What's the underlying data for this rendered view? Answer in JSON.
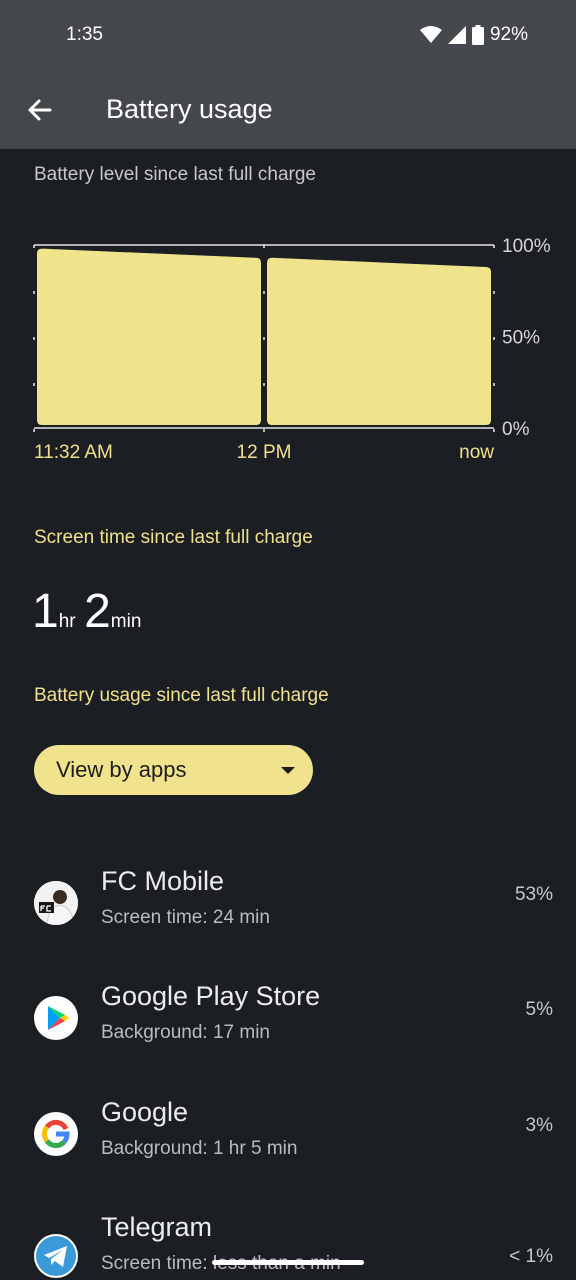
{
  "status": {
    "time": "1:35",
    "battery": "92%"
  },
  "header": {
    "title": "Battery usage"
  },
  "chart_label": "Battery level since last full charge",
  "chart_data": {
    "type": "area",
    "x_labels": [
      "11:32 AM",
      "12 PM",
      "now"
    ],
    "y_labels": [
      "100%",
      "50%",
      "0%"
    ],
    "ylim": [
      0,
      100
    ],
    "segments": [
      {
        "start": 98,
        "end": 93
      },
      {
        "start": 93,
        "end": 88
      }
    ],
    "colors": {
      "fill": "#efe38c",
      "axis": "#e6e6e6",
      "label": "#efe08c"
    }
  },
  "screen_time": {
    "title": "Screen time since last full charge",
    "hours": "1",
    "hours_unit": "hr",
    "minutes": "2",
    "minutes_unit": "min"
  },
  "usage": {
    "title": "Battery usage since last full charge",
    "dropdown": "View by apps"
  },
  "apps": [
    {
      "name": "FC Mobile",
      "detail": "Screen time: 24 min",
      "percent": "53%",
      "icon": "fc-mobile-icon"
    },
    {
      "name": "Google Play Store",
      "detail": "Background: 17 min",
      "percent": "5%",
      "icon": "google-play-icon"
    },
    {
      "name": "Google",
      "detail": "Background: 1 hr 5 min",
      "percent": "3%",
      "icon": "google-icon"
    },
    {
      "name": "Telegram",
      "detail": "Screen time: less than a min",
      "percent": "< 1%",
      "icon": "telegram-icon"
    }
  ]
}
